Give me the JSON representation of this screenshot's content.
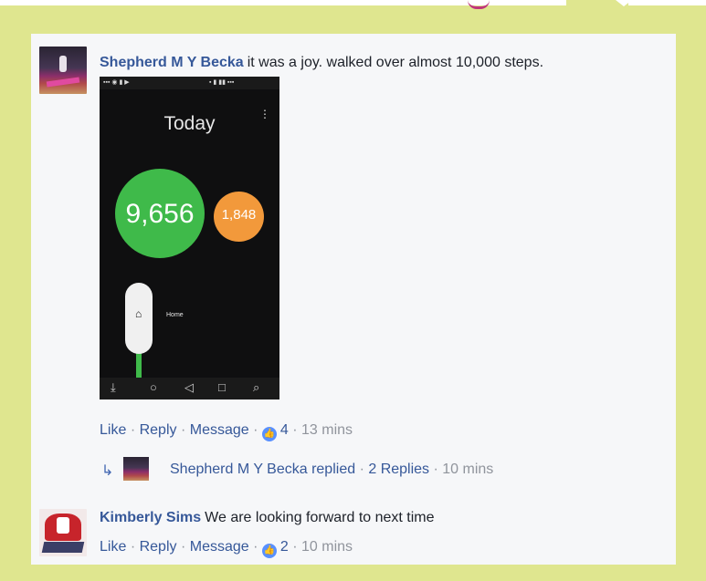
{
  "comment1": {
    "author": "Shepherd M Y Becka",
    "text": "it was a joy. walked over almost 10,000 steps.",
    "actions": {
      "like": "Like",
      "reply": "Reply",
      "message": "Message",
      "reactions": "4",
      "time": "13 mins"
    }
  },
  "phone_screen": {
    "title": "Today",
    "steps": "9,656",
    "calories": "1,848",
    "home_label": "Home"
  },
  "replies": {
    "author": "Shepherd M Y Becka",
    "replied": "replied",
    "count": "2 Replies",
    "time": "10 mins"
  },
  "comment2": {
    "author": "Kimberly Sims",
    "text": "We are looking forward to next time",
    "actions": {
      "like": "Like",
      "reply": "Reply",
      "message": "Message",
      "reactions": "2",
      "time": "10 mins"
    }
  },
  "colors": {
    "background": "#dfe68f",
    "link": "#365899",
    "steps_green": "#3fba4a",
    "calories_orange": "#f2993b"
  }
}
